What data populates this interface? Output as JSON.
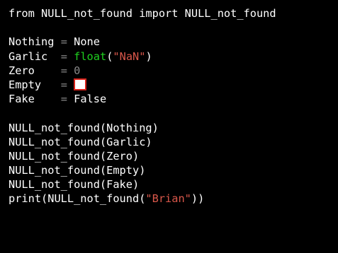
{
  "editor": {
    "lines": [
      {
        "text": "from NULL_not_found import NULL_not_found"
      },
      {
        "text": ""
      },
      {
        "name": "Nothing",
        "pad": " ",
        "eq": "=",
        "value": "None"
      },
      {
        "name": "Garlic",
        "pad": "  ",
        "eq": "=",
        "fn": "float",
        "open": "(",
        "str": "\"NaN\"",
        "close": ")"
      },
      {
        "name": "Zero",
        "pad": "    ",
        "eq": "=",
        "num": "0"
      },
      {
        "name": "Empty",
        "pad": "   ",
        "eq": "="
      },
      {
        "name": "Fake",
        "pad": "    ",
        "eq": "=",
        "value": "False"
      },
      {
        "text": ""
      },
      {
        "text": "NULL_not_found(Nothing)"
      },
      {
        "text": "NULL_not_found(Garlic)"
      },
      {
        "text": "NULL_not_found(Zero)"
      },
      {
        "text": "NULL_not_found(Empty)"
      },
      {
        "text": "NULL_not_found(Fake)"
      },
      {
        "pre": "print(NULL_not_found(",
        "str": "\"Brian\"",
        "post": "))"
      }
    ],
    "colors": {
      "background": "#000000",
      "text": "#ffffff",
      "operator": "#8a8a8a",
      "builtin": "#1fd11f",
      "string": "#d9574a",
      "empty_box_border": "#d9231b"
    }
  }
}
